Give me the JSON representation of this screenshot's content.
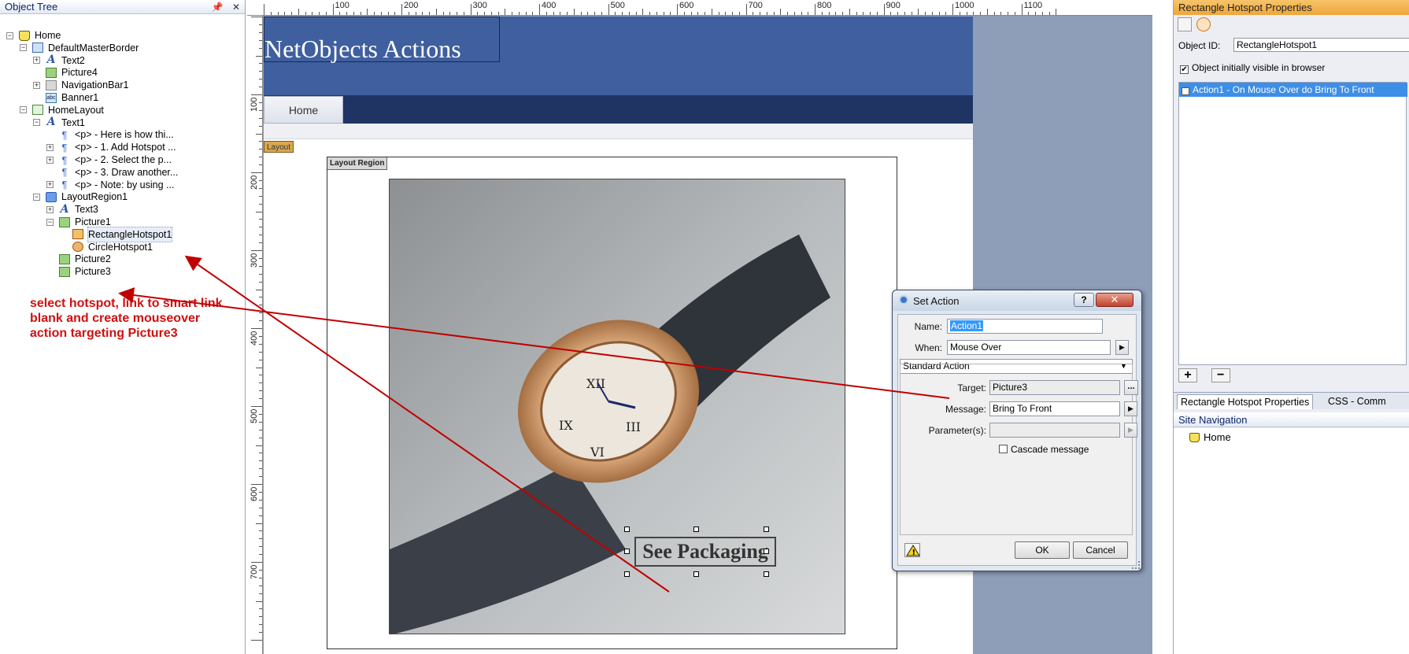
{
  "object_tree": {
    "title": "Object Tree",
    "pin_icon": "pin-icon",
    "close_icon": "close-icon",
    "items": [
      {
        "label": "Home",
        "icon": "home-page-icon"
      },
      {
        "label": "DefaultMasterBorder",
        "icon": "master-border-icon"
      },
      {
        "label": "Text2",
        "icon": "text-icon"
      },
      {
        "label": "Picture4",
        "icon": "picture-icon"
      },
      {
        "label": "NavigationBar1",
        "icon": "navbar-icon"
      },
      {
        "label": "Banner1",
        "icon": "banner-icon"
      },
      {
        "label": "HomeLayout",
        "icon": "layout-icon"
      },
      {
        "label": "Text1",
        "icon": "text-icon"
      },
      {
        "label": "<p> - Here is how thi...",
        "icon": "paragraph-icon"
      },
      {
        "label": "<p> - 1. Add Hotspot ...",
        "icon": "paragraph-icon"
      },
      {
        "label": "<p> - 2. Select the p...",
        "icon": "paragraph-icon"
      },
      {
        "label": "<p> - 3. Draw another...",
        "icon": "paragraph-icon"
      },
      {
        "label": "<p> - Note: by using ...",
        "icon": "paragraph-icon"
      },
      {
        "label": "LayoutRegion1",
        "icon": "layout-region-icon"
      },
      {
        "label": "Text3",
        "icon": "text-icon"
      },
      {
        "label": "Picture1",
        "icon": "picture-icon"
      },
      {
        "label": "RectangleHotspot1",
        "icon": "rectangle-hotspot-icon"
      },
      {
        "label": "CircleHotspot1",
        "icon": "circle-hotspot-icon"
      },
      {
        "label": "Picture2",
        "icon": "picture-icon"
      },
      {
        "label": "Picture3",
        "icon": "picture-icon"
      }
    ]
  },
  "annotation": {
    "text": "select hotspot, link to smart link blank and create mouseover action targeting Picture3",
    "color": "#d01010"
  },
  "ruler": {
    "top_labels": [
      "100",
      "200",
      "300",
      "400",
      "500",
      "600",
      "700",
      "800",
      "900",
      "1000",
      "1100"
    ],
    "left_labels": [
      "100",
      "200",
      "300",
      "400",
      "500",
      "600",
      "700"
    ]
  },
  "page": {
    "banner_title": "NetObjects Actions",
    "nav_home": "Home",
    "layout_tag": "Layout",
    "layout_region_tag": "Layout Region",
    "hotspot_text": "See Packaging",
    "banner_color": "#3f5f9e",
    "nav_color": "#1f3463"
  },
  "properties": {
    "title": "Rectangle Hotspot Properties",
    "object_id_label": "Object ID:",
    "object_id_value": "RectangleHotspot1",
    "visible_label": "Object initially visible in browser",
    "visible_checked": "✔",
    "action_item": "Action1 - On Mouse Over do Bring To Front",
    "action_checked": "✔",
    "add_label": "+",
    "remove_label": "−",
    "tabs": [
      "Rectangle Hotspot Properties",
      "CSS - Comm"
    ],
    "site_nav_title": "Site Navigation",
    "site_nav_home": "Home",
    "accent_color": "#eea63a"
  },
  "dialog": {
    "title": "Set Action",
    "help_label": "?",
    "close_label": "✕",
    "name_label": "Name:",
    "name_value": "Action1",
    "when_label": "When:",
    "when_value": "Mouse Over",
    "type_value": "Standard Action",
    "target_label": "Target:",
    "target_value": "Picture3",
    "target_browse": "...",
    "message_label": "Message:",
    "message_value": "Bring To Front",
    "parameter_label": "Parameter(s):",
    "parameter_value": "",
    "cascade_label": "Cascade message",
    "ok_label": "OK",
    "cancel_label": "Cancel"
  }
}
